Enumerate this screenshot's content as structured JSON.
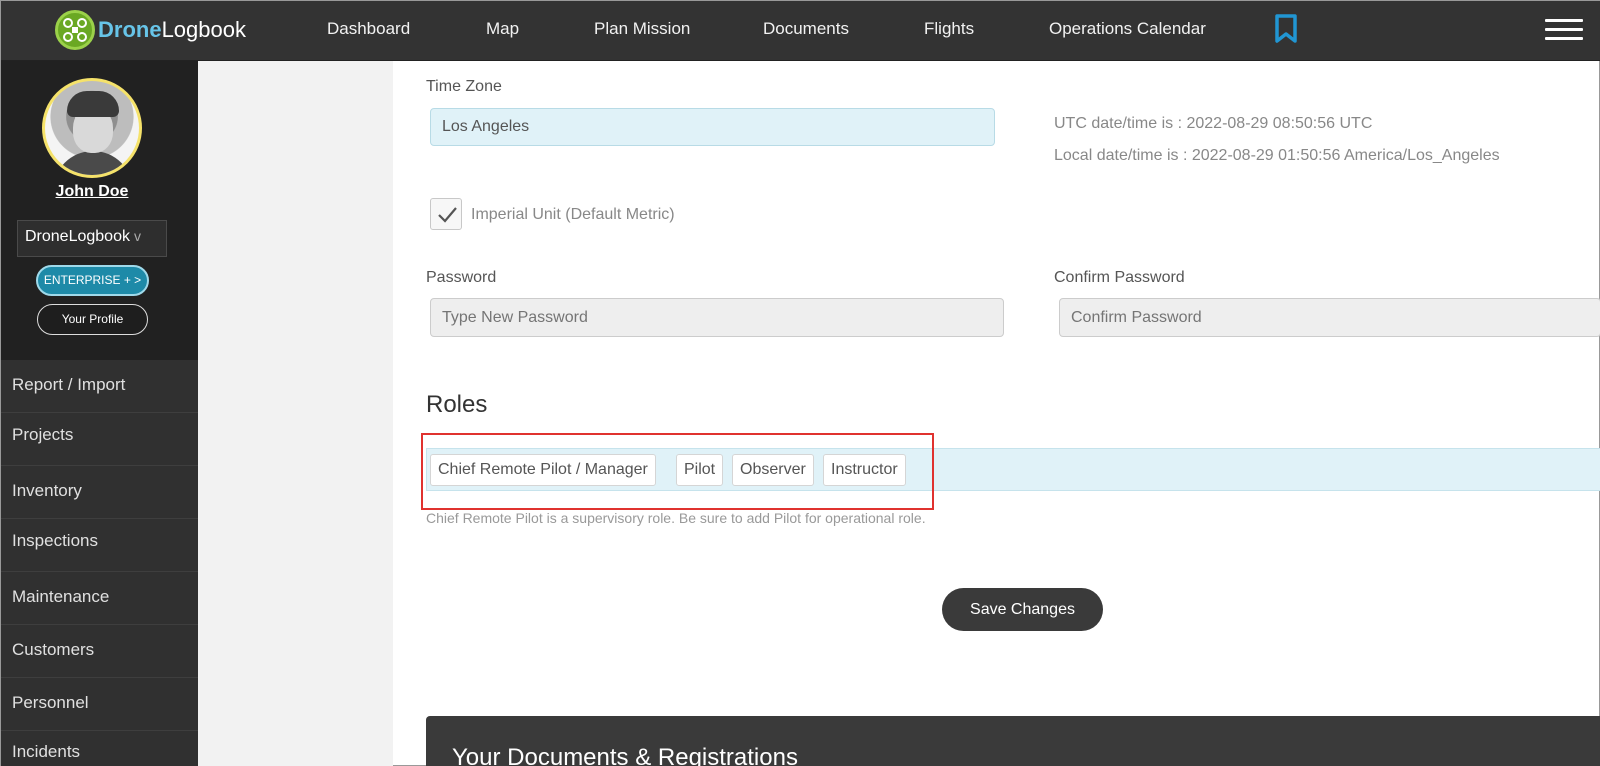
{
  "app": {
    "logo_part1": "Drone",
    "logo_part2": "Logbook"
  },
  "nav": {
    "items": [
      "Dashboard",
      "Map",
      "Plan Mission",
      "Documents",
      "Flights",
      "Operations Calendar"
    ]
  },
  "sidebar": {
    "user_name": "John Doe",
    "organization": "DroneLogbook",
    "org_chevron": "v",
    "plan_button": "ENTERPRISE + >",
    "profile_button": "Your Profile",
    "menu": [
      "Report / Import",
      "Projects",
      "Inventory",
      "Inspections",
      "Maintenance",
      "Customers",
      "Personnel",
      "Incidents"
    ]
  },
  "form": {
    "timezone_label": "Time Zone",
    "timezone_value": "Los Angeles",
    "utc_info": "UTC date/time is : 2022-08-29 08:50:56 UTC",
    "local_info": "Local date/time is : 2022-08-29 01:50:56 America/Los_Angeles",
    "imperial_label": "Imperial Unit (Default Metric)",
    "imperial_checked": true,
    "password_label": "Password",
    "password_placeholder": "Type New Password",
    "confirm_label": "Confirm Password",
    "confirm_placeholder": "Confirm Password",
    "roles_title": "Roles",
    "roles": [
      "Chief Remote Pilot / Manager",
      "Pilot",
      "Observer",
      "Instructor"
    ],
    "roles_hint": "Chief Remote Pilot is a supervisory role. Be sure to add Pilot for operational role.",
    "save_button": "Save Changes"
  },
  "documents": {
    "title": "Your Documents & Registrations"
  },
  "colors": {
    "topbar": "#333333",
    "sidebar": "#2b2b2b",
    "accent_blue": "#1e8aa8",
    "input_blue": "#e0f2f8",
    "highlight_red": "#e0322f",
    "logo_green": "#6aa823"
  }
}
